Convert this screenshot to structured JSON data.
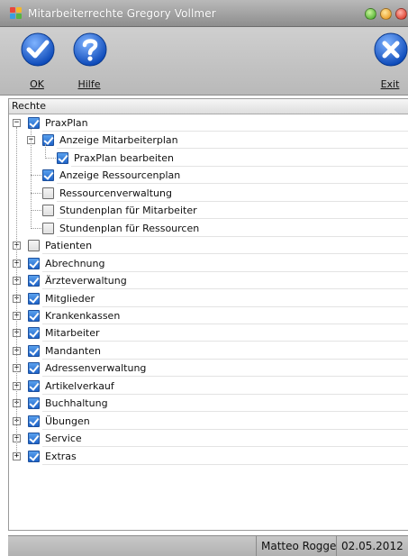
{
  "window": {
    "title": "Mitarbeiterrechte Gregory Vollmer",
    "app_icon": "app-grid-icon",
    "controls": [
      "maximize-icon",
      "minimize-icon",
      "close-icon"
    ]
  },
  "toolbar": {
    "ok_label": "OK",
    "help_label": "Hilfe",
    "exit_label": "Exit",
    "ok_icon": "check-circle-icon",
    "help_icon": "question-circle-icon",
    "exit_icon": "x-circle-icon"
  },
  "tree": {
    "column_header": "Rechte",
    "nodes": [
      {
        "label": "PraxPlan",
        "checked": true,
        "expander": "minus",
        "level": 0
      },
      {
        "label": "Anzeige Mitarbeiterplan",
        "checked": true,
        "expander": "minus",
        "level": 1
      },
      {
        "label": "PraxPlan bearbeiten",
        "checked": true,
        "expander": "none",
        "level": 2
      },
      {
        "label": "Anzeige Ressourcenplan",
        "checked": true,
        "expander": "none",
        "level": 1
      },
      {
        "label": "Ressourcenverwaltung",
        "checked": false,
        "expander": "none",
        "level": 1
      },
      {
        "label": "Stundenplan für Mitarbeiter",
        "checked": false,
        "expander": "none",
        "level": 1
      },
      {
        "label": "Stundenplan für Ressourcen",
        "checked": false,
        "expander": "none",
        "level": 1
      },
      {
        "label": "Patienten",
        "checked": false,
        "expander": "plus",
        "level": 0
      },
      {
        "label": "Abrechnung",
        "checked": true,
        "expander": "plus",
        "level": 0
      },
      {
        "label": "Ärzteverwaltung",
        "checked": true,
        "expander": "plus",
        "level": 0
      },
      {
        "label": "Mitglieder",
        "checked": true,
        "expander": "plus",
        "level": 0
      },
      {
        "label": "Krankenkassen",
        "checked": true,
        "expander": "plus",
        "level": 0
      },
      {
        "label": "Mitarbeiter",
        "checked": true,
        "expander": "plus",
        "level": 0
      },
      {
        "label": "Mandanten",
        "checked": true,
        "expander": "plus",
        "level": 0
      },
      {
        "label": "Adressenverwaltung",
        "checked": true,
        "expander": "plus",
        "level": 0
      },
      {
        "label": "Artikelverkauf",
        "checked": true,
        "expander": "plus",
        "level": 0
      },
      {
        "label": "Buchhaltung",
        "checked": true,
        "expander": "plus",
        "level": 0
      },
      {
        "label": "Übungen",
        "checked": true,
        "expander": "plus",
        "level": 0
      },
      {
        "label": "Service",
        "checked": true,
        "expander": "plus",
        "level": 0
      },
      {
        "label": "Extras",
        "checked": true,
        "expander": "plus",
        "level": 0
      }
    ]
  },
  "status": {
    "user": "Matteo Rogge",
    "date": "02.05.2012"
  },
  "colors": {
    "checkbox_checked": "#1e63c8",
    "ok_button": "#1f66d6",
    "help_button": "#1f66d6",
    "exit_button": "#1f66d6"
  }
}
